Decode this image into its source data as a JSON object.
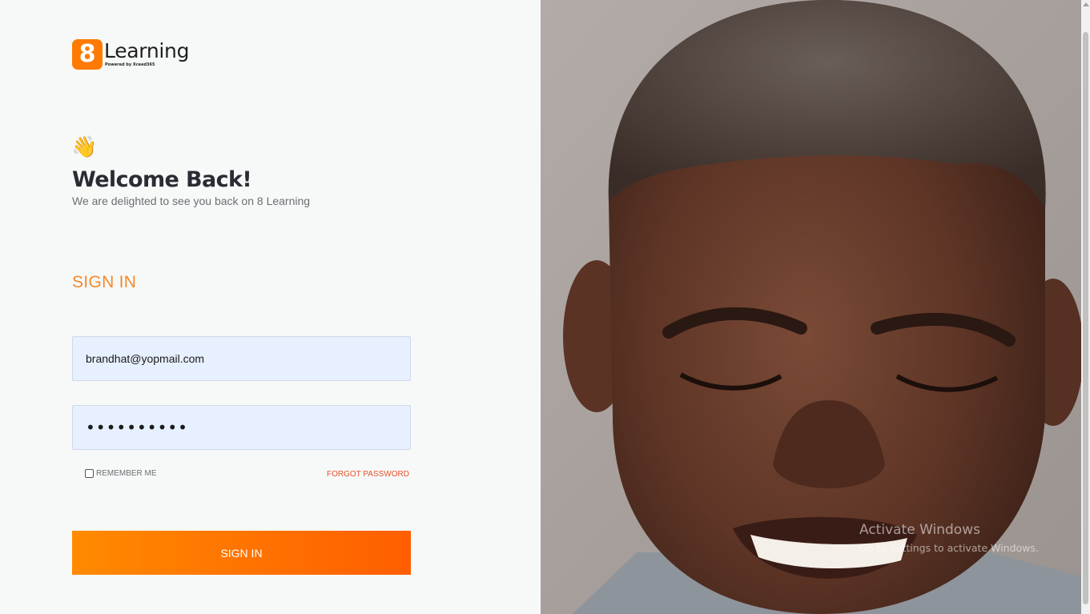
{
  "brand": {
    "logo_mark": "8",
    "logo_word": "Learning",
    "powered_by": "Powered by Xceed365",
    "accent_color": "#ff7a00"
  },
  "welcome": {
    "emoji": "👋",
    "title": "Welcome Back!",
    "subtitle": "We are delighted to see you back on 8 Learning"
  },
  "form": {
    "heading": "SIGN IN",
    "email_value": "brandhat@yopmail.com",
    "password_value": "••••••••••",
    "remember_label": "REMEMBER ME",
    "remember_checked": false,
    "forgot_label": "FORGOT PASSWORD",
    "submit_label": "SIGN IN"
  },
  "hero_image": {
    "description_icon": "photo-of-smiling-man"
  },
  "os_watermark": {
    "title": "Activate Windows",
    "subtitle": "Go to Settings to activate Windows."
  }
}
